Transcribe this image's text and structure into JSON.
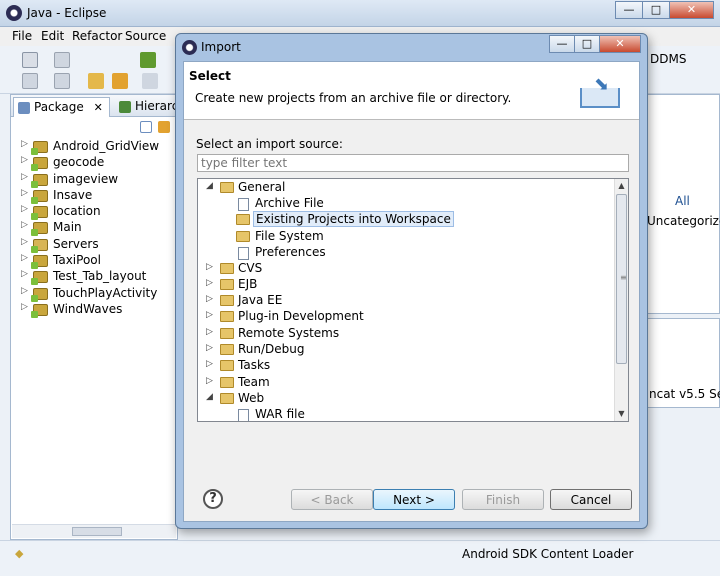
{
  "window": {
    "title": "Java - Eclipse",
    "controls": {
      "minimize": "—",
      "maximize": "□",
      "close": "✕"
    }
  },
  "menubar": [
    "File",
    "Edit",
    "Refactor",
    "Source"
  ],
  "toolbar": {
    "ddms_label": "DDMS"
  },
  "left_panel": {
    "active_tab": "Package",
    "active_tab_close": "✕",
    "other_tab": "Hierarch",
    "projects": [
      "Android_GridView",
      "geocode",
      "imageview",
      "Insave",
      "location",
      "Main",
      "Servers",
      "TaxiPool",
      "Test_Tab_layout",
      "TouchPlayActivity",
      "WindWaves"
    ]
  },
  "right_panel": {
    "all_label": "All",
    "uncategorized": "Uncategorize",
    "server": "ncat v5.5 Se"
  },
  "statusbar": {
    "loader": "Android SDK Content Loader"
  },
  "dialog": {
    "title": "Import",
    "header_title": "Select",
    "header_subtitle": "Create new projects from an archive file or directory.",
    "source_label": "Select an import source:",
    "filter_placeholder": "type filter text",
    "tree": {
      "general": "General",
      "general_children": [
        "Archive File",
        "Existing Projects into Workspace",
        "File System",
        "Preferences"
      ],
      "selected": "Existing Projects into Workspace",
      "categories": [
        "CVS",
        "EJB",
        "Java EE",
        "Plug-in Development",
        "Remote Systems",
        "Run/Debug",
        "Tasks",
        "Team"
      ],
      "web": "Web",
      "web_children": [
        "WAR file"
      ]
    },
    "buttons": {
      "help": "?",
      "back": "< Back",
      "next": "Next >",
      "finish": "Finish",
      "cancel": "Cancel"
    }
  }
}
